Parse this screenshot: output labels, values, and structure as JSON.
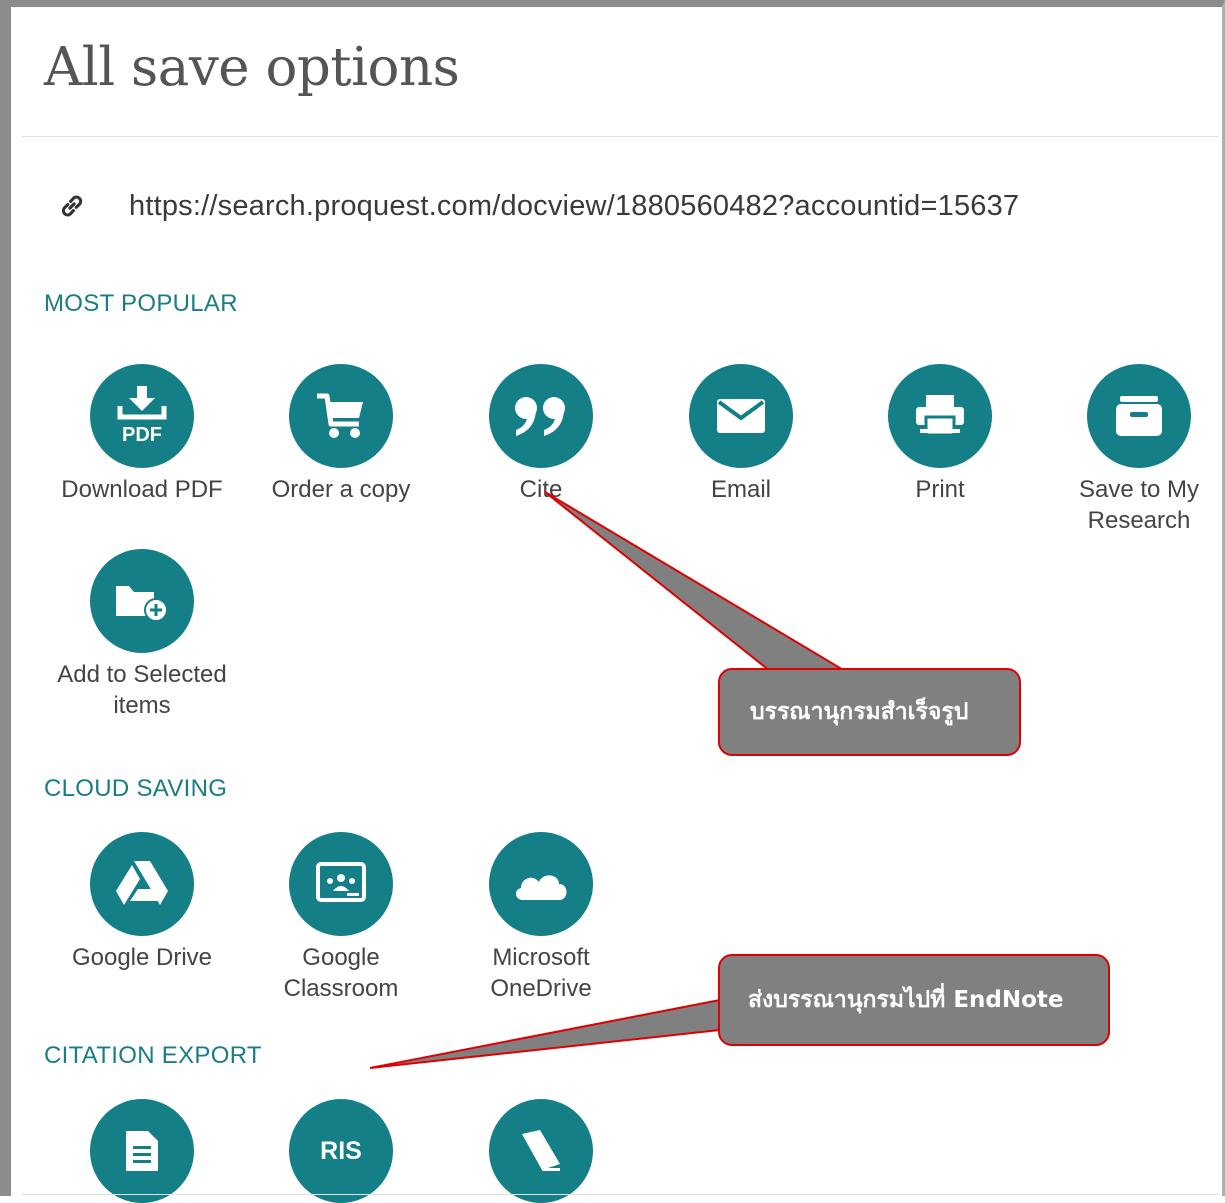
{
  "header": {
    "title": "All save options"
  },
  "link": {
    "url": "https://search.proquest.com/docview/1880560482?accountid=15637"
  },
  "sections": {
    "most_popular": "MOST POPULAR",
    "cloud_saving": "CLOUD SAVING",
    "citation_export": "CITATION EXPORT"
  },
  "most_popular": [
    {
      "label": "Download PDF",
      "icon": "download-pdf-icon",
      "badge": "PDF"
    },
    {
      "label": "Order a copy",
      "icon": "cart-icon"
    },
    {
      "label": "Cite",
      "icon": "quote-icon"
    },
    {
      "label": "Email",
      "icon": "envelope-icon"
    },
    {
      "label": "Print",
      "icon": "printer-icon"
    },
    {
      "label": "Save to My Research",
      "icon": "archive-box-icon"
    },
    {
      "label": "Add to Selected items",
      "icon": "folder-add-icon"
    }
  ],
  "cloud_saving": [
    {
      "label": "Google Drive",
      "icon": "google-drive-icon"
    },
    {
      "label": "Google Classroom",
      "icon": "google-classroom-icon"
    },
    {
      "label": "Microsoft OneDrive",
      "icon": "onedrive-cloud-icon"
    }
  ],
  "citation_export": [
    {
      "icon": "document-icon"
    },
    {
      "icon": "ris-icon",
      "badge": "RIS"
    },
    {
      "icon": "book-icon"
    }
  ],
  "callouts": {
    "cite": "บรรณานุกรมสำเร็จรูป",
    "endnote": "ส่งบรรณานุกรมไปที่ EndNote"
  },
  "colors": {
    "accent": "#147f86",
    "section_text": "#1a7d86",
    "callout_fill": "#808080",
    "callout_border": "#e00000"
  }
}
